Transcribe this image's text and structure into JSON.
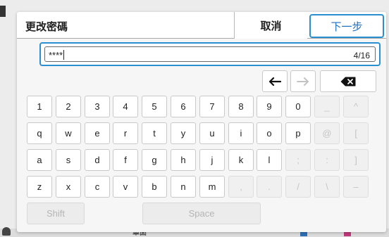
{
  "background": {
    "bottom_text": "單面"
  },
  "dialog": {
    "title": "更改密碼",
    "cancel_label": "取消",
    "next_label": "下一步"
  },
  "input": {
    "value": "****",
    "counter": "4/16"
  },
  "keyboard": {
    "nav": {
      "left_icon": "arrow-left-icon",
      "right_icon": "arrow-right-icon",
      "right_enabled": false,
      "backspace_icon": "backspace-icon"
    },
    "row1": [
      "1",
      "2",
      "3",
      "4",
      "5",
      "6",
      "7",
      "8",
      "9",
      "0",
      "_",
      "^"
    ],
    "row2": [
      "q",
      "w",
      "e",
      "r",
      "t",
      "y",
      "u",
      "i",
      "o",
      "p",
      "@",
      "["
    ],
    "row3": [
      "a",
      "s",
      "d",
      "f",
      "g",
      "h",
      "j",
      "k",
      "l",
      ";",
      ":",
      "]"
    ],
    "row4": [
      "z",
      "x",
      "c",
      "v",
      "b",
      "n",
      "m",
      ",",
      ".",
      "/",
      "\\",
      "–"
    ],
    "disabled_keys": [
      "_",
      "^",
      "@",
      "[",
      ";",
      ":",
      "]",
      ",",
      ".",
      "/",
      "\\",
      "–"
    ],
    "shift_label": "Shift",
    "space_label": "Space"
  },
  "colors": {
    "accent": "#2a8fd0",
    "next_text": "#1b6fc1"
  }
}
